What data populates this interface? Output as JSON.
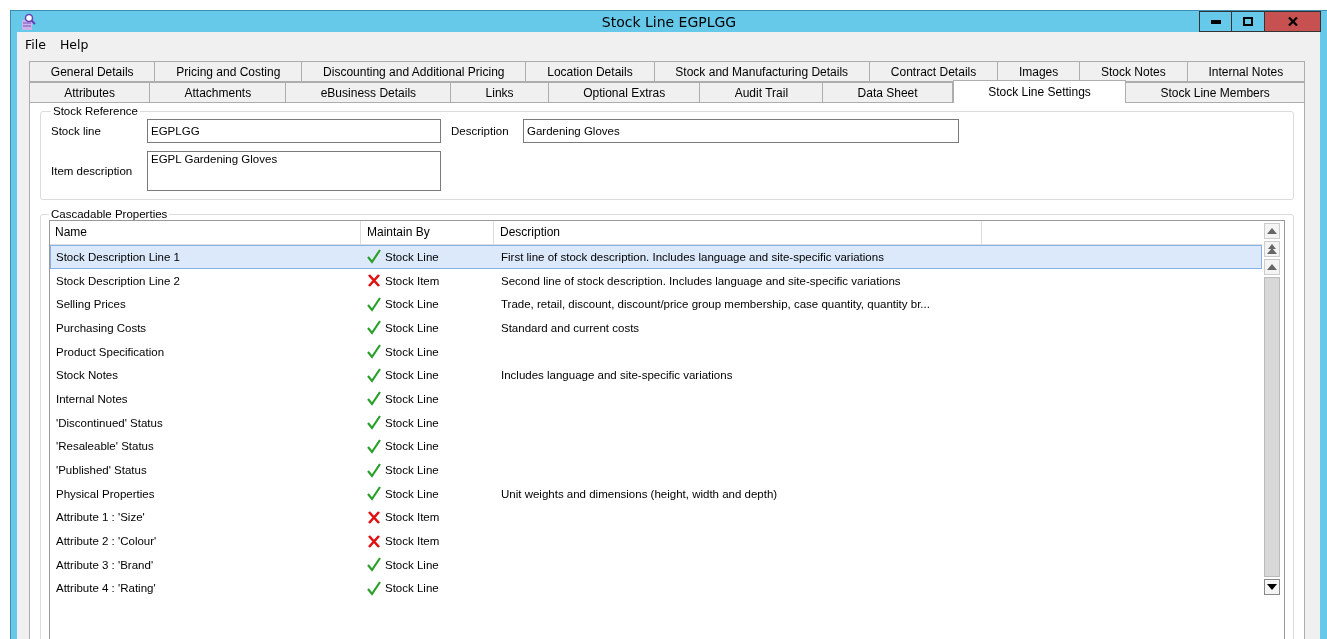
{
  "window": {
    "title": "Stock Line EGPLGG"
  },
  "menu": [
    "File",
    "Help"
  ],
  "tab_rows": [
    [
      {
        "label": "General Details",
        "selected": false
      },
      {
        "label": "Pricing and Costing",
        "selected": false
      },
      {
        "label": "Discounting and Additional Pricing",
        "selected": false
      },
      {
        "label": "Location Details",
        "selected": false
      },
      {
        "label": "Stock and Manufacturing Details",
        "selected": false
      },
      {
        "label": "Contract Details",
        "selected": false
      },
      {
        "label": "Images",
        "selected": false
      },
      {
        "label": "Stock Notes",
        "selected": false
      },
      {
        "label": "Internal Notes",
        "selected": false
      }
    ],
    [
      {
        "label": "Attributes",
        "selected": false
      },
      {
        "label": "Attachments",
        "selected": false
      },
      {
        "label": "eBusiness Details",
        "selected": false
      },
      {
        "label": "Links",
        "selected": false
      },
      {
        "label": "Optional Extras",
        "selected": false
      },
      {
        "label": "Audit Trail",
        "selected": false
      },
      {
        "label": "Data Sheet",
        "selected": false
      },
      {
        "label": "Stock Line Settings",
        "selected": true
      },
      {
        "label": "Stock Line Members",
        "selected": false
      }
    ]
  ],
  "stock_reference": {
    "title": "Stock Reference",
    "stock_line": {
      "label": "Stock line",
      "value": "EGPLGG"
    },
    "description": {
      "label": "Description",
      "value": "Gardening Gloves"
    },
    "item_description": {
      "label": "Item description",
      "value": "EGPL Gardening Gloves"
    }
  },
  "cascadable_properties": {
    "title": "Cascadable Properties",
    "columns": [
      "Name",
      "Maintain By",
      "Description"
    ],
    "rows": [
      {
        "name": "Stock Description Line 1",
        "kind": "tick",
        "maintain_by": "Stock Line",
        "description": "First line of stock description. Includes language and site-specific variations",
        "selected": true
      },
      {
        "name": "Stock Description Line 2",
        "kind": "cross",
        "maintain_by": "Stock Item",
        "description": "Second line of stock description. Includes language and site-specific variations",
        "selected": false
      },
      {
        "name": "Selling Prices",
        "kind": "tick",
        "maintain_by": "Stock Line",
        "description": "Trade, retail, discount, discount/price group membership, case quantity, quantity br...",
        "selected": false
      },
      {
        "name": "Purchasing Costs",
        "kind": "tick",
        "maintain_by": "Stock Line",
        "description": "Standard and current costs",
        "selected": false
      },
      {
        "name": "Product Specification",
        "kind": "tick",
        "maintain_by": "Stock Line",
        "selected": false
      },
      {
        "name": "Stock Notes",
        "kind": "tick",
        "maintain_by": "Stock Line",
        "description": "Includes language and site-specific variations",
        "selected": false
      },
      {
        "name": "Internal Notes",
        "kind": "tick",
        "maintain_by": "Stock Line",
        "selected": false
      },
      {
        "name": "'Discontinued' Status",
        "kind": "tick",
        "maintain_by": "Stock Line",
        "selected": false
      },
      {
        "name": "'Resaleable' Status",
        "kind": "tick",
        "maintain_by": "Stock Line",
        "selected": false
      },
      {
        "name": "'Published' Status",
        "kind": "tick",
        "maintain_by": "Stock Line",
        "selected": false
      },
      {
        "name": "Physical Properties",
        "kind": "tick",
        "maintain_by": "Stock Line",
        "description": "Unit weights and dimensions (height, width and depth)",
        "selected": false
      },
      {
        "name": "Attribute 1 : 'Size'",
        "kind": "cross",
        "maintain_by": "Stock Item",
        "selected": false
      },
      {
        "name": "Attribute 2 : 'Colour'",
        "kind": "cross",
        "maintain_by": "Stock Item",
        "selected": false
      },
      {
        "name": "Attribute 3 : 'Brand'",
        "kind": "tick",
        "maintain_by": "Stock Line",
        "selected": false
      },
      {
        "name": "Attribute 4 : 'Rating'",
        "kind": "tick",
        "maintain_by": "Stock Line",
        "selected": false
      }
    ]
  }
}
